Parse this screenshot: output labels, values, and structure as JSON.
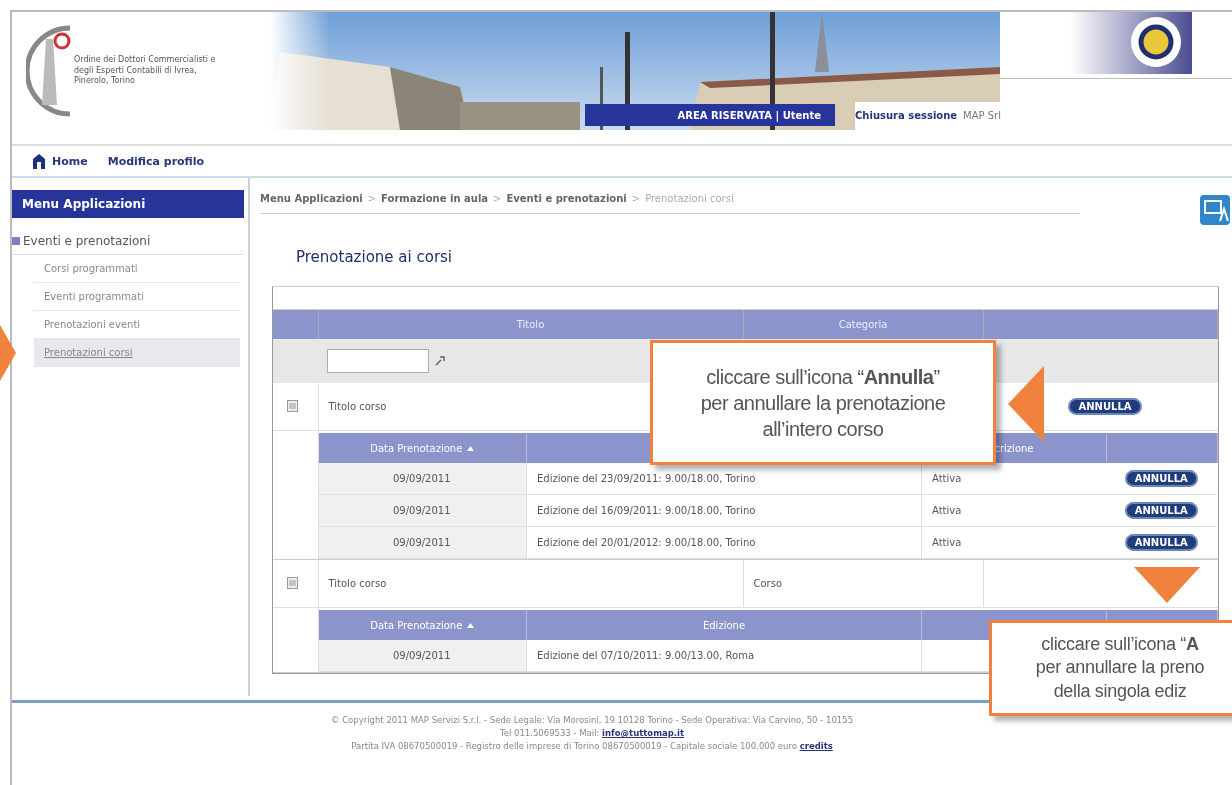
{
  "header": {
    "logo_text": "Ordine dei Dottori Commercialisti e degli Esperti Contabili di Ivrea, Pinerolo, Torino",
    "area_label": "AREA RISERVATA | Utente",
    "logout": "Chiusura sessione",
    "user": "MAP Srl"
  },
  "nav": [
    {
      "label": "Home",
      "kind": "home"
    },
    {
      "label": "Modifica profilo",
      "kind": "link"
    }
  ],
  "sidebar": {
    "title": "Menu Applicazioni",
    "section": "Eventi e prenotazioni",
    "items": [
      {
        "label": "Corsi programmati",
        "selected": false
      },
      {
        "label": "Eventi programmati",
        "selected": false
      },
      {
        "label": "Prenotazioni eventi",
        "selected": false
      },
      {
        "label": "Prenotazioni corsi",
        "selected": true
      }
    ]
  },
  "breadcrumb": [
    {
      "label": "Menu Applicazioni",
      "current": false
    },
    {
      "separator": ">",
      "label": "Formazione in aula",
      "current": false
    },
    {
      "separator": ">",
      "label": "Eventi e prenotazioni",
      "current": false
    },
    {
      "separator": ">",
      "label": "Prenotazioni corsi",
      "current": true
    }
  ],
  "page_title": "Prenotazione ai corsi",
  "table": {
    "columns": [
      "Titolo",
      "Categoria"
    ],
    "groups": [
      {
        "title": "Titolo corso",
        "action": "ANNULLA",
        "columns": [
          {
            "kind": "label",
            "label": "Data Prenotazione",
            "sorted": true
          },
          {
            "kind": "blank"
          },
          {
            "kind": "label",
            "label": "crizione",
            "sorted": false
          },
          {
            "kind": "blank"
          }
        ],
        "rows": [
          {
            "date": "09/09/2011",
            "edition": "Edizione del 23/09/2011: 9.00/18.00, Torino",
            "status": "Attiva",
            "action": "ANNULLA"
          },
          {
            "date": "09/09/2011",
            "edition": "Edizione del 16/09/2011: 9.00/18.00, Torino",
            "status": "Attiva",
            "action": "ANNULLA"
          },
          {
            "date": "09/09/2011",
            "edition": "Edizione del 20/01/2012: 9.00/18.00, Torino",
            "status": "Attiva",
            "action": "ANNULLA"
          }
        ]
      },
      {
        "title": "Titolo corso",
        "category": "Corso",
        "columns": [
          {
            "kind": "label",
            "label": "Data Prenotazione",
            "sorted": true
          },
          {
            "kind": "label",
            "label": "Edizione",
            "sorted": false
          },
          {
            "kind": "blank"
          },
          {
            "kind": "blank"
          }
        ],
        "rows": [
          {
            "date": "09/09/2011",
            "edition": "Edizione del 07/10/2011: 9.00/13.00, Roma"
          }
        ]
      }
    ]
  },
  "footer": {
    "line_1": "© Copyright 2011 MAP Servizi S.r.l. - Sede Legale: Via Morosini, 19 10128 Torino - Sede Operativa: Via Carvino, 50 - 10155",
    "line_2": "Tel 011.5069533 - Mail:",
    "email": "info@tuttomap.it",
    "line_3": "Partita IVA 08670500019  -  Registro delle imprese di Torino 08670500019 - Capitale sociale 100.000 euro",
    "credits": "credits"
  },
  "callouts": [
    {
      "kind": "left",
      "lines": [
        "cliccare sull’icona “**Annulla**”",
        "per annullare la prenotazione",
        "all’intero corso"
      ]
    },
    {
      "kind": "down",
      "lines": [
        "cliccare sull’icona “**A**",
        "per annullare la preno",
        "della singola ediz"
      ]
    }
  ]
}
